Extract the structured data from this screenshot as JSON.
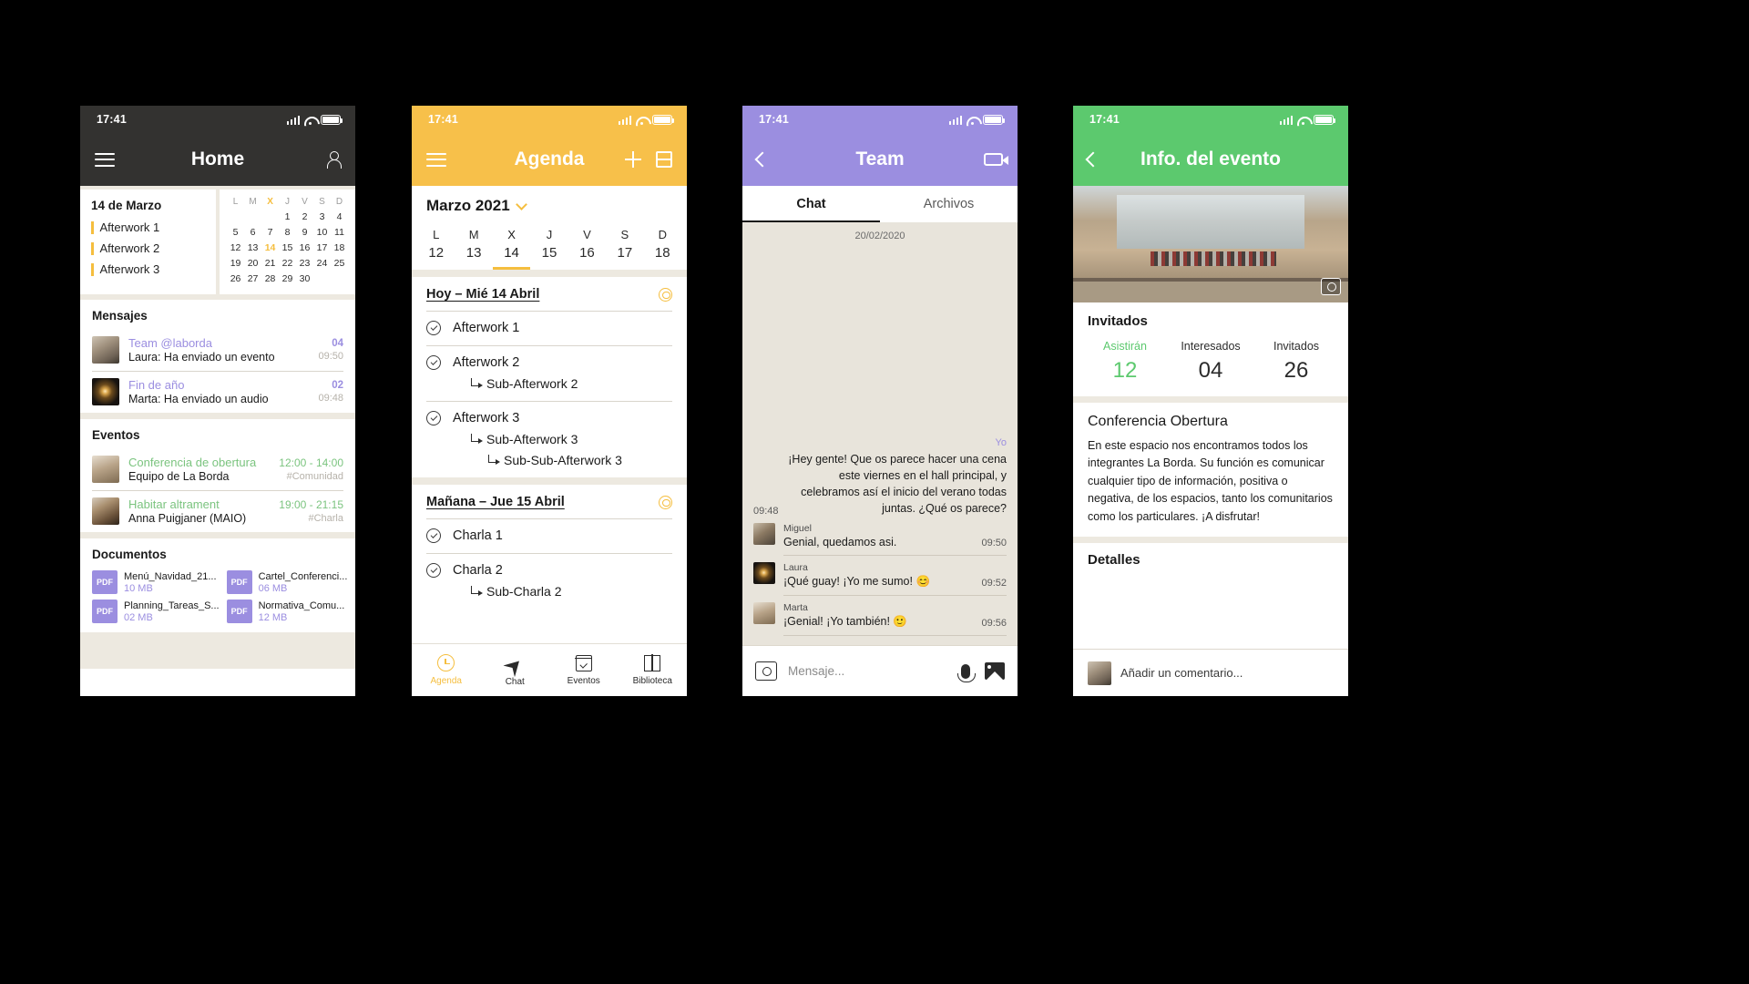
{
  "status": {
    "time": "17:41"
  },
  "phone1": {
    "nav": {
      "title": "Home",
      "menu_icon": "hamburger-icon",
      "profile_icon": "person-icon"
    },
    "day_card": {
      "date": "14 de Marzo",
      "events": [
        "Afterwork 1",
        "Afterwork 2",
        "Afterwork 3"
      ]
    },
    "calendar": {
      "weekday_headers": [
        "L",
        "M",
        "X",
        "J",
        "V",
        "S",
        "D"
      ],
      "today_header_index": 2,
      "weeks": [
        [
          "",
          "",
          "",
          "1",
          "2",
          "3",
          "4"
        ],
        [
          "5",
          "6",
          "7",
          "8",
          "9",
          "10",
          "11"
        ],
        [
          "12",
          "13",
          "14",
          "15",
          "16",
          "17",
          "18"
        ],
        [
          "19",
          "20",
          "21",
          "22",
          "23",
          "24",
          "25"
        ],
        [
          "26",
          "27",
          "28",
          "29",
          "30",
          "",
          ""
        ]
      ],
      "today": "14"
    },
    "messages": {
      "title": "Mensajes",
      "items": [
        {
          "name": "Team @laborda",
          "preview": "Laura: Ha enviado un evento",
          "count": "04",
          "time": "09:50"
        },
        {
          "name": "Fin de año",
          "preview": "Marta: Ha enviado un audio",
          "count": "02",
          "time": "09:48"
        }
      ]
    },
    "events": {
      "title": "Eventos",
      "items": [
        {
          "name": "Conferencia de obertura",
          "author": "Equipo de La Borda",
          "time": "12:00 - 14:00",
          "tag": "#Comunidad"
        },
        {
          "name": "Habitar altrament",
          "author": "Anna Puigjaner (MAIO)",
          "time": "19:00 - 21:15",
          "tag": "#Charla"
        }
      ]
    },
    "documents": {
      "title": "Documentos",
      "items": [
        {
          "type": "PDF",
          "name": "Menú_Navidad_21...",
          "size": "10 MB"
        },
        {
          "type": "PDF",
          "name": "Cartel_Conferenci...",
          "size": "06 MB"
        },
        {
          "type": "PDF",
          "name": "Planning_Tareas_S...",
          "size": "02 MB"
        },
        {
          "type": "PDF",
          "name": "Normativa_Comu...",
          "size": "12 MB"
        }
      ]
    }
  },
  "phone2": {
    "nav": {
      "title": "Agenda",
      "menu_icon": "hamburger-icon",
      "add_icon": "plus-icon",
      "view_icon": "split-view-icon"
    },
    "month": {
      "label": "Marzo 2021",
      "chevron": "chevron-down-icon"
    },
    "week": {
      "days": [
        {
          "d": "L",
          "n": "12"
        },
        {
          "d": "M",
          "n": "13"
        },
        {
          "d": "X",
          "n": "14"
        },
        {
          "d": "J",
          "n": "15"
        },
        {
          "d": "V",
          "n": "16"
        },
        {
          "d": "S",
          "n": "17"
        },
        {
          "d": "D",
          "n": "18"
        }
      ],
      "active_index": 2
    },
    "sections": [
      {
        "header": "Hoy – Mié 14 Abril",
        "tasks": [
          {
            "title": "Afterwork 1",
            "subs": []
          },
          {
            "title": "Afterwork 2",
            "subs": [
              "Sub-Afterwork 2"
            ]
          },
          {
            "title": "Afterwork 3",
            "subs": [
              "Sub-Afterwork 3",
              "Sub-Sub-Afterwork 3"
            ]
          }
        ]
      },
      {
        "header": "Mañana – Jue 15 Abril",
        "tasks": [
          {
            "title": "Charla 1",
            "subs": []
          },
          {
            "title": "Charla 2",
            "subs": [
              "Sub-Charla 2"
            ]
          }
        ]
      }
    ],
    "tabs": [
      {
        "label": "Agenda",
        "icon": "clock-icon",
        "active": true
      },
      {
        "label": "Chat",
        "icon": "send-icon",
        "active": false
      },
      {
        "label": "Eventos",
        "icon": "calendar-check-icon",
        "active": false
      },
      {
        "label": "Biblioteca",
        "icon": "book-icon",
        "active": false
      }
    ]
  },
  "phone3": {
    "nav": {
      "title": "Team",
      "back_icon": "chevron-left-icon",
      "video_icon": "video-call-icon"
    },
    "tabs": [
      {
        "label": "Chat",
        "active": true
      },
      {
        "label": "Archivos",
        "active": false
      }
    ],
    "date_divider": "20/02/2020",
    "outgoing": {
      "who": "Yo",
      "time": "09:48",
      "text": "¡Hey gente! Que os parece hacer una cena este viernes en el hall principal, y celebramos así el inicio del verano todas juntas. ¿Qué os parece?"
    },
    "incoming": [
      {
        "name": "Miguel",
        "text": "Genial, quedamos asi.",
        "time": "09:50"
      },
      {
        "name": "Laura",
        "text": "¡Qué guay! ¡Yo me sumo! 😊",
        "time": "09:52"
      },
      {
        "name": "Marta",
        "text": "¡Genial! ¡Yo también! 🙂",
        "time": "09:56"
      }
    ],
    "composer": {
      "placeholder": "Mensaje...",
      "camera_icon": "camera-icon",
      "mic_icon": "microphone-icon",
      "image_icon": "image-icon"
    }
  },
  "phone4": {
    "nav": {
      "title": "Info. del evento",
      "back_icon": "chevron-left-icon"
    },
    "hero": {
      "camera_icon": "camera-icon"
    },
    "guests": {
      "title": "Invitados",
      "stats": [
        {
          "label": "Asistirán",
          "value": "12",
          "highlight": true
        },
        {
          "label": "Interesados",
          "value": "04",
          "highlight": false
        },
        {
          "label": "Invitados",
          "value": "26",
          "highlight": false
        }
      ]
    },
    "event": {
      "title": "Conferencia Obertura",
      "description": "En este espacio nos encontramos todos los integrantes La Borda. Su función es comunicar cualquier tipo de información, positiva o negativa, de los espacios, tanto los comunitarios como los particulares. ¡A disfrutar!",
      "details_header": "Detalles"
    },
    "comment": {
      "placeholder": "Añadir un comentario..."
    }
  },
  "colors": {
    "dark": "#333230",
    "yellow": "#F7C04A",
    "purple": "#9B8EE0",
    "green": "#5CC96E",
    "beige": "#EDE9E0",
    "chat_bg": "#E8E4DB"
  }
}
